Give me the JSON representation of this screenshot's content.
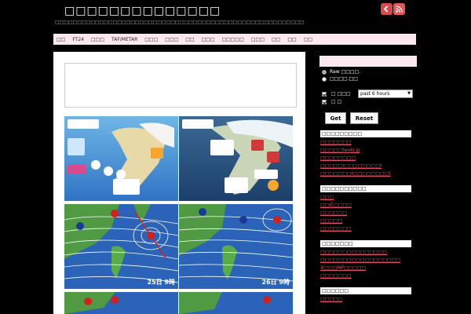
{
  "header": {
    "title": "□□□□□□□□□□□□□□",
    "description": "□□□□□□□□□□□□□□□□□□□□□□□□□□□□□□□□□□□□□□□□□□□□□□□□□□□□□□□□"
  },
  "nav": [
    "□□",
    "FT24",
    "□□□",
    "TAF/METAR",
    "□□□",
    "□□□",
    "□□",
    "□□□",
    "□□□□□",
    "□□□",
    "□□",
    "□□",
    "□□"
  ],
  "sidebar": {
    "radio_1": "Raw □□□□.",
    "radio_2": "□□□□.□□",
    "check_1": "□ □□□",
    "check_2": "□ □",
    "period_select": "past 6 hours",
    "get_button": "Get",
    "reset_button": "Reset",
    "sections": [
      {
        "heading": "□□□□□□□□□",
        "links": [
          "□□□□□□□",
          "□□□□□tenki.jp",
          "□□□□□□□□",
          "□□□□□(□□□□□□□□)",
          "□□□□□□□(□□□□□□□□)"
        ]
      },
      {
        "heading": "□□□□□□□□□□",
        "links": [
          "□□□",
          "□□IC□□□□",
          "□□□□□□",
          "□□□□□",
          "□□□□□□□"
        ]
      },
      {
        "heading": "□□□□□□□",
        "links": [
          "□□□□□□□□□□□□□□□",
          "□□□□□□□□□□□□□□□□□□",
          "X□□□MP□□□□□",
          "□□□□□□□"
        ]
      },
      {
        "heading": "□□□□□□",
        "links": [
          "□□□□□"
        ]
      }
    ]
  },
  "thumbs": [
    {
      "label": ""
    },
    {
      "label": ""
    },
    {
      "label": "25日 9時"
    },
    {
      "label": "26日 9時"
    }
  ],
  "colors": {
    "accent_pink": "#fde8ee",
    "link": "#e0506a",
    "background": "#000000"
  }
}
